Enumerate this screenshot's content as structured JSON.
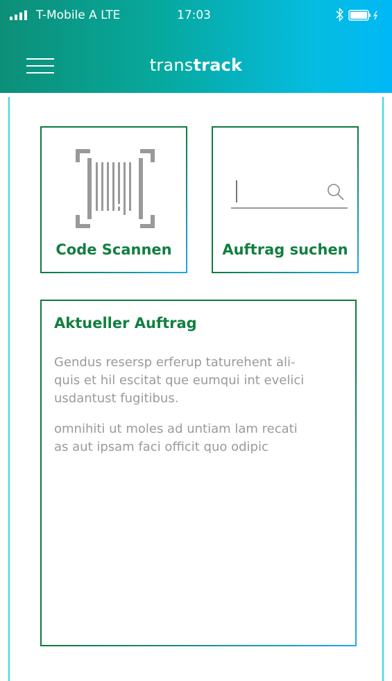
{
  "status_bar": {
    "carrier": "T-Mobile A  LTE",
    "time": "17:03"
  },
  "header": {
    "title_light": "trans",
    "title_bold": "track"
  },
  "tiles": {
    "scan_label": "Code Scannen",
    "search_label": "Auftrag suchen"
  },
  "current_order": {
    "title": "Aktueller Auftrag",
    "paragraph1": [
      "Gendus resersp erferup taturehent ali-",
      "quis et hil escitat que eumqui int evelici",
      "usdantust fugitibus."
    ],
    "paragraph2": [
      "omnihiti ut moles ad untiam lam recati",
      "as aut ipsam faci officit quo odipic"
    ]
  },
  "icons": {
    "menu": "hamburger-menu-icon",
    "scan": "barcode-scan-icon",
    "search": "magnifier-icon",
    "signal": "signal-bars-icon",
    "bluetooth": "bluetooth-icon",
    "battery": "battery-icon"
  },
  "colors": {
    "brand_green": "#127f41",
    "header_start": "#0c8f78",
    "header_end": "#01b8f6",
    "accent_blue": "#21a8e6",
    "body_text": "#9a9a9a"
  }
}
